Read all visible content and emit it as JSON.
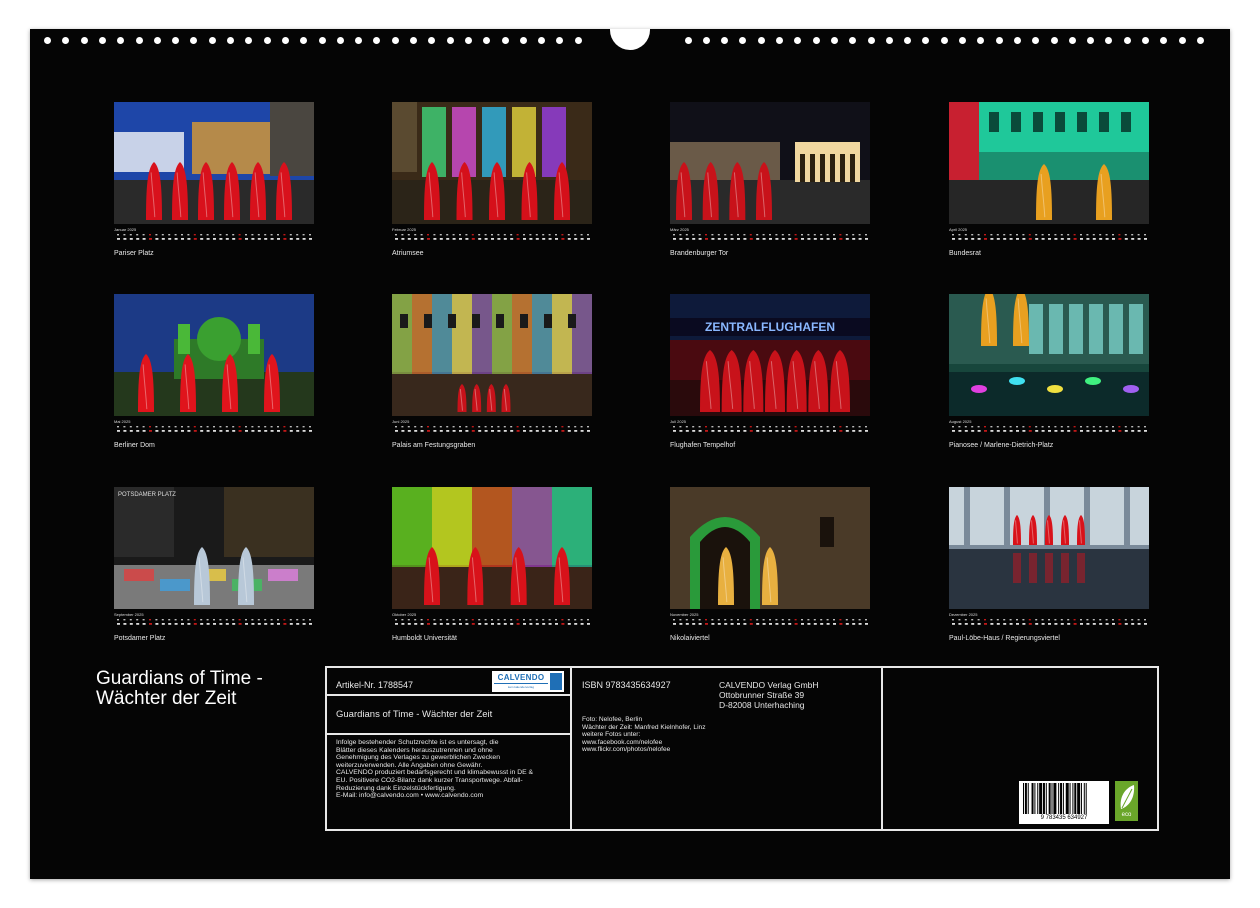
{
  "months": [
    {
      "short": "Januar 2025",
      "caption": "Pariser Platz",
      "scene": "redfigs",
      "sky": "#1e46a8",
      "ground": "#2a2a2a",
      "figs": 6,
      "fig": "#d8111c",
      "accent": "#d9e0f0",
      "weekdays": "M D M D F S S"
    },
    {
      "short": "Februar 2025",
      "caption": "Atriumsee",
      "scene": "fountain",
      "sky": "#3a2a18",
      "ground": "#2b2418",
      "figs": 5,
      "fig": "#d5101a",
      "accent": "#6df0a0"
    },
    {
      "short": "März 2025",
      "caption": "Brandenburger Tor",
      "scene": "gate",
      "sky": "#101018",
      "ground": "#2a2a2a",
      "figs": 4,
      "fig": "#c8121a",
      "accent": "#f0d7a0"
    },
    {
      "short": "April 2025",
      "caption": "Bundesrat",
      "scene": "glowing",
      "sky": "#1a9070",
      "ground": "#262626",
      "figs": 2,
      "fig": "#e8a020",
      "accent": "#22e8a8"
    },
    {
      "short": "Mai 2025",
      "caption": "Berliner Dom",
      "scene": "dome",
      "sky": "#1c3a86",
      "ground": "#24381c",
      "figs": 4,
      "fig": "#e0141c",
      "accent": "#5cc02c"
    },
    {
      "short": "Juni 2025",
      "caption": "Palais am Festungsgraben",
      "scene": "palais",
      "sky": "#6a8a3a",
      "ground": "#38281c",
      "figs": 4,
      "fig": "#c8121a",
      "accent": "#d8e068"
    },
    {
      "short": "Juli 2025",
      "caption": "Flughafen Tempelhof",
      "scene": "airport",
      "sky": "#0e1a3a",
      "ground": "#2a0a0c",
      "figs": 7,
      "fig": "#c8121a",
      "accent": "#8ab8ff",
      "sign": "ZENTRALFLUGHAFEN"
    },
    {
      "short": "August 2025",
      "caption": "Pianosee / Marlene-Dietrich-Platz",
      "scene": "pianosee",
      "sky": "#17463c",
      "ground": "#0c2a2a",
      "figs": 2,
      "fig": "#e8a020",
      "accent": "#60d8c8"
    },
    {
      "short": "September 2025",
      "caption": "Potsdamer Platz",
      "scene": "potsdamer",
      "sky": "#1a1a1a",
      "ground": "#7a7a7a",
      "figs": 2,
      "fig": "#b8c8d8",
      "accent": "#40c060",
      "sign": "POTSDAMER PLATZ"
    },
    {
      "short": "Oktober 2025",
      "caption": "Humboldt Universität",
      "scene": "humboldt",
      "sky": "#4a8a20",
      "ground": "#3a2418",
      "figs": 4,
      "fig": "#d8121a",
      "accent": "#e0e020"
    },
    {
      "short": "November 2025",
      "caption": "Nikolaiviertel",
      "scene": "nikolai",
      "sky": "#4a3a28",
      "ground": "#3a2c1c",
      "figs": 2,
      "fig": "#e8b040",
      "accent": "#30c040"
    },
    {
      "short": "Dezember 2025",
      "caption": "Paul-Löbe-Haus / Regierungsviertel",
      "scene": "paulloebe",
      "sky": "#7a8a9a",
      "ground": "#1e2630",
      "figs": 5,
      "fig": "#d8121a",
      "accent": "#dfe8ee"
    }
  ],
  "title": {
    "line1": "Guardians of Time -",
    "line2": "Wächter der Zeit"
  },
  "info": {
    "artikel": "Artikel-Nr. 1788547",
    "logo_text": "CALVENDO",
    "logo_sub": "kein kalenderverlag",
    "subtitle": "Guardians of Time - Wächter der Zeit",
    "legal": [
      "Infolge bestehender Schutzrechte ist es untersagt, die",
      "Blätter dieses Kalenders herauszutrennen und ohne",
      "Genehmigung des Verlages zu gewerblichen Zwecken",
      "weiterzuverwenden. Alle Angaben ohne Gewähr.",
      "CALVENDO produziert bedarfsgerecht und klimabewusst in DE &",
      "EU. Positivere CO2-Bilanz dank kurzer Transportwege. Abfall-",
      "Reduzierung dank Einzelstückfertigung.",
      "E-Mail: info@calvendo.com • www.calvendo.com"
    ],
    "isbn": "ISBN 9783435634927",
    "publisher": [
      "CALVENDO Verlag GmbH",
      "Ottobrunner Straße 39",
      "D-82008 Unterhaching"
    ],
    "credits": [
      "Foto: Nelofee, Berlin",
      "Wächter der Zeit: Manfred Kielnhofer, Linz",
      "weitere Fotos unter:",
      "www.facebook.com/nelofee",
      "www.flickr.com/photos/nelofee"
    ],
    "barcode_number": "9 783435 634927",
    "eco_label": "eco"
  },
  "colors": {
    "background": "#050505",
    "line": "#e8e8e8",
    "sunday": "#c01818",
    "calvendo_blue": "#1f6fb6",
    "eco_green": "#6aa62a"
  }
}
